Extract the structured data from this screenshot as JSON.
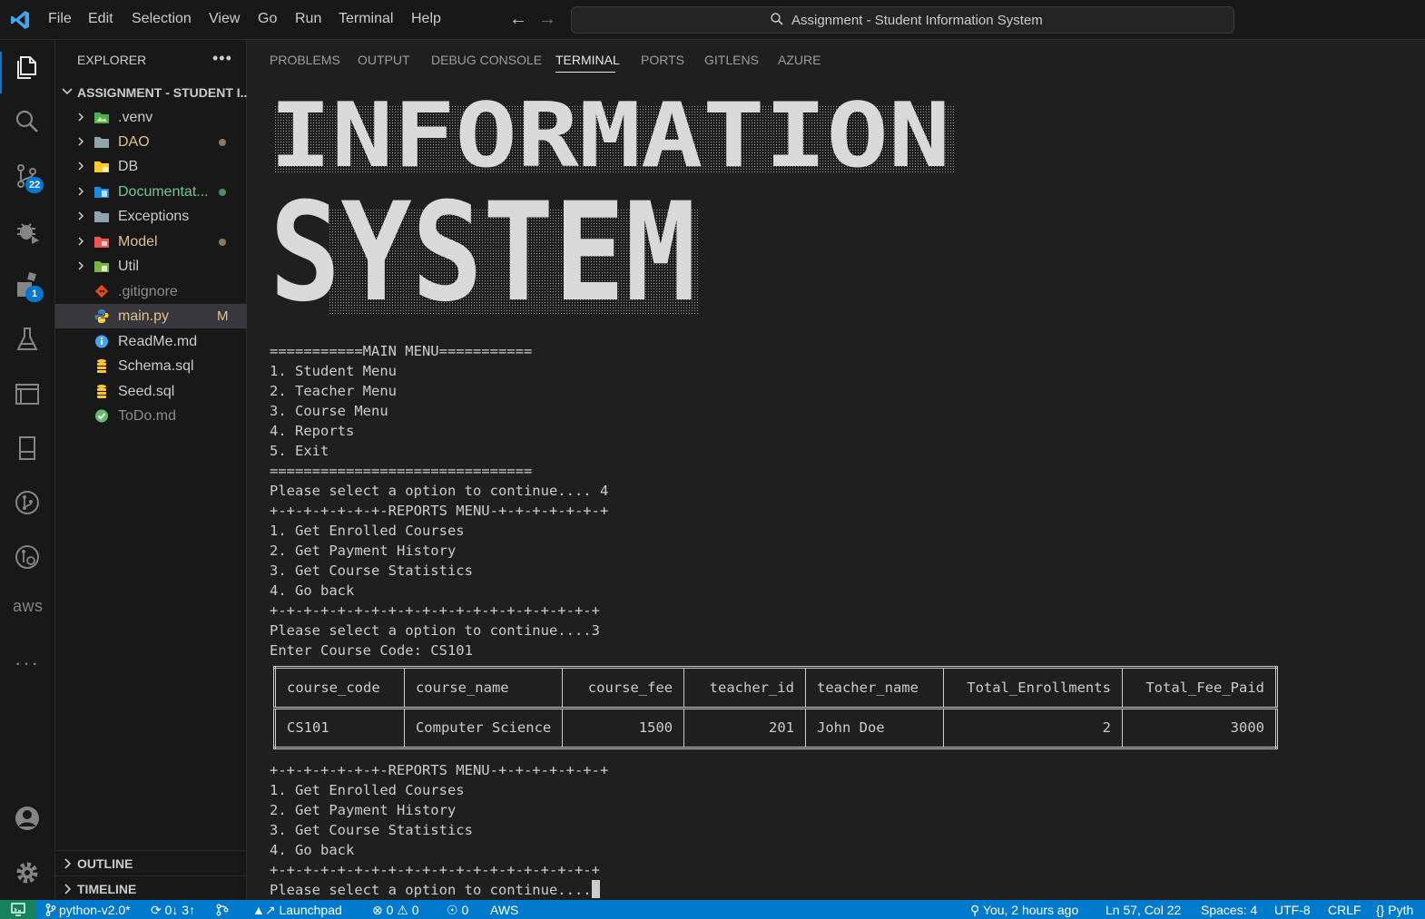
{
  "menu": [
    "File",
    "Edit",
    "Selection",
    "View",
    "Go",
    "Run",
    "Terminal",
    "Help"
  ],
  "command_center": "Assignment - Student Information System",
  "activity_badges": {
    "source_control": "22",
    "extensions": "1"
  },
  "activity_aws_label": "aws",
  "sidebar": {
    "title": "EXPLORER",
    "folder": "ASSIGNMENT - STUDENT I...",
    "items": [
      {
        "label": ".venv",
        "color": "#cccccc"
      },
      {
        "label": "DAO",
        "color": "#e2c08d"
      },
      {
        "label": "DB",
        "color": "#cccccc"
      },
      {
        "label": "Documentat...",
        "color": "#73c991"
      },
      {
        "label": "Exceptions",
        "color": "#cccccc"
      },
      {
        "label": "Model",
        "color": "#e2c08d"
      },
      {
        "label": "Util",
        "color": "#cccccc"
      },
      {
        "label": ".gitignore",
        "color": "#8c8c8c"
      },
      {
        "label": "main.py",
        "color": "#e2c08d",
        "status": "M"
      },
      {
        "label": "ReadMe.md",
        "color": "#cccccc"
      },
      {
        "label": "Schema.sql",
        "color": "#cccccc"
      },
      {
        "label": "Seed.sql",
        "color": "#cccccc"
      },
      {
        "label": "ToDo.md",
        "color": "#8c8c8c"
      }
    ],
    "outline": "OUTLINE",
    "timeline": "TIMELINE"
  },
  "panel_tabs": [
    "PROBLEMS",
    "OUTPUT",
    "DEBUG CONSOLE",
    "TERMINAL",
    "PORTS",
    "GITLENS",
    "AZURE"
  ],
  "terminal": {
    "banner_line1": "INFORMATION",
    "banner_line2": "SYSTEM",
    "lines_top": [
      "===========MAIN MENU===========",
      "1. Student Menu",
      "2. Teacher Menu",
      "3. Course Menu",
      "4. Reports",
      "5. Exit",
      "===============================",
      "Please select a option to continue.... 4",
      "+-+-+-+-+-+-+-REPORTS MENU-+-+-+-+-+-+-+",
      "1. Get Enrolled Courses",
      "2. Get Payment History",
      "3. Get Course Statistics",
      "4. Go back",
      "+-+-+-+-+-+-+-+-+-+-+-+-+-+-+-+-+-+-+-+",
      "Please select a option to continue....3",
      "Enter Course Code: CS101"
    ],
    "table": {
      "headers": [
        "course_code",
        "course_name",
        "course_fee",
        "teacher_id",
        "teacher_name",
        "Total_Enrollments",
        "Total_Fee_Paid"
      ],
      "row": [
        "CS101",
        "Computer Science",
        "1500",
        "201",
        "John Doe",
        "2",
        "3000"
      ]
    },
    "lines_bottom": [
      "+-+-+-+-+-+-+-REPORTS MENU-+-+-+-+-+-+-+",
      "1. Get Enrolled Courses",
      "2. Get Payment History",
      "3. Get Course Statistics",
      "4. Go back",
      "+-+-+-+-+-+-+-+-+-+-+-+-+-+-+-+-+-+-+-+",
      "Please select a option to continue...."
    ]
  },
  "statusbar": {
    "branch": "python-v2.0*",
    "sync": "0↓ 3↑",
    "launchpad": "Launchpad",
    "errors": "0",
    "warnings": "0",
    "ports": "0",
    "aws": "AWS",
    "blame": "You, 2 hours ago",
    "position": "Ln 57, Col 22",
    "spaces": "Spaces: 4",
    "encoding": "UTF-8",
    "eol": "CRLF",
    "language": "Pyth"
  }
}
